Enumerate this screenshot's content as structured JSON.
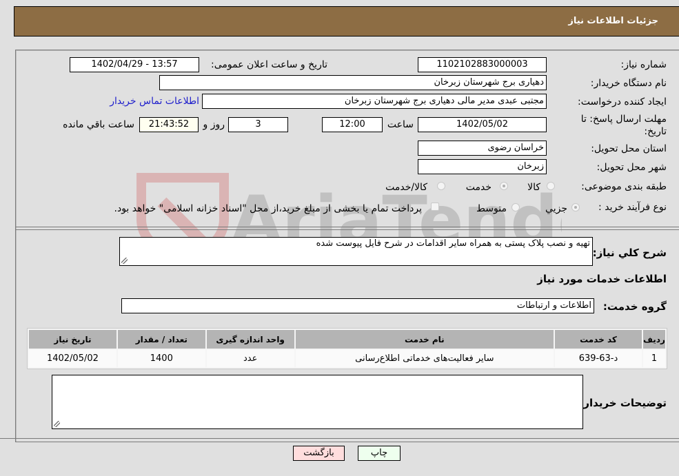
{
  "header": {
    "title": "جزئیات اطلاعات نیاز"
  },
  "form": {
    "need_number": {
      "label": "شماره نیاز:",
      "value": "1102102883000003"
    },
    "announce_datetime": {
      "label": "تاریخ و ساعت اعلان عمومی:",
      "value": "1402/04/29 - 13:57"
    },
    "buyer_org": {
      "label": "نام دستگاه خریدار:",
      "value": "دهیاری برج شهرستان زبرخان"
    },
    "requester": {
      "label": "ایجاد کننده درخواست:",
      "value": "مجتبی عبدی مدیر مالی  دهیاری برج شهرستان زبرخان"
    },
    "buyer_contact_link": "اطلاعات تماس خریدار",
    "deadline": {
      "label_line1": "مهلت ارسال پاسخ: تا",
      "label_line2": "تاریخ:",
      "date": "1402/05/02",
      "time_label": "ساعت",
      "time": "12:00",
      "days": "3",
      "days_label": "روز و",
      "remaining": "21:43:52",
      "remaining_label": "ساعت باقي مانده"
    },
    "delivery_province": {
      "label": "استان محل تحویل:",
      "value": "خراسان رضوی"
    },
    "delivery_city": {
      "label": "شهر محل تحویل:",
      "value": "زبرخان"
    },
    "category": {
      "label": "طبقه بندی موضوعی:",
      "options": [
        "کالا",
        "خدمت",
        "کالا/خدمت"
      ],
      "selected": "خدمت"
    },
    "purchase_type": {
      "label": "نوع فرآیند خرید :",
      "options": [
        "جزيي",
        "متوسط"
      ],
      "selected": "جزيي",
      "treasury_note": "پرداخت تمام یا بخشی از مبلغ خرید،از محل \"اسناد خزانه اسلامی\" خواهد بود."
    },
    "description": {
      "label": "شرح کلي نياز:",
      "value": "تهیه و نصب پلاک پستی به همراه سایر اقدامات در شرح فایل پیوست شده"
    },
    "services_heading": "اطلاعات خدمات مورد نیاز",
    "service_group": {
      "label": "گروه خدمت:",
      "value": "اطلاعات و ارتباطات"
    }
  },
  "table": {
    "headers": [
      "ردیف",
      "کد خدمت",
      "نام خدمت",
      "واحد اندازه گیری",
      "تعداد / مقدار",
      "تاریخ نیاز"
    ],
    "rows": [
      [
        "1",
        "د-63-639",
        "سایر فعالیت‌های خدماتی اطلاع‌رسانی",
        "عدد",
        "1400",
        "1402/05/02"
      ]
    ]
  },
  "buyer_notes": {
    "label": "توضیحات خریدار:",
    "value": ""
  },
  "buttons": {
    "print": "چاپ",
    "back": "بازگشت"
  },
  "colors": {
    "header_bg": "#8d6d44",
    "print_bg": "#eeffee",
    "back_bg": "#ffdddd",
    "link": "#2020cc"
  },
  "watermark": {
    "text": "AriaTender.neT"
  }
}
